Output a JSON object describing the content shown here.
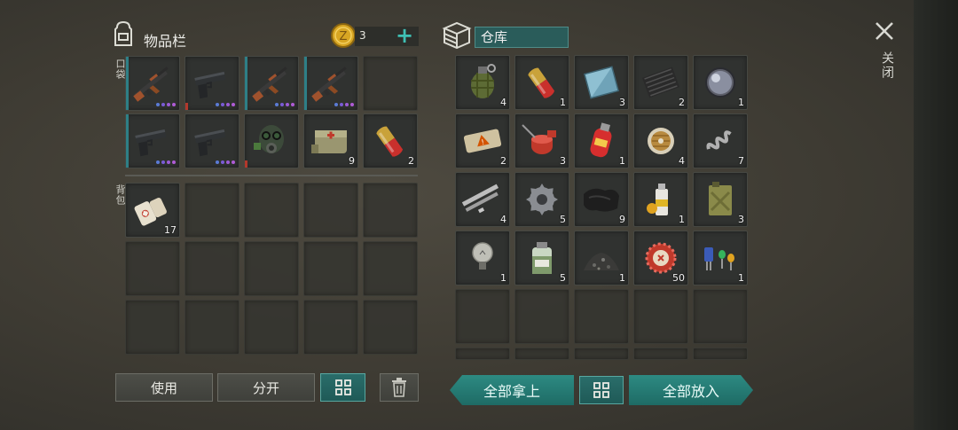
{
  "inventory": {
    "title": "物品栏",
    "coins": "3",
    "pocket_label": "口袋",
    "backpack_label": "背包",
    "pocket_items": [
      {
        "icon": "assault-rifle-icon",
        "count": ""
      },
      {
        "icon": "pistol-icon",
        "count": ""
      },
      {
        "icon": "assault-rifle-icon",
        "count": ""
      },
      {
        "icon": "assault-rifle-icon",
        "count": ""
      },
      {
        "icon": "",
        "count": ""
      },
      {
        "icon": "pistol-icon",
        "count": ""
      },
      {
        "icon": "pistol-icon",
        "count": ""
      },
      {
        "icon": "gas-mask-icon",
        "count": ""
      },
      {
        "icon": "medkit-bag-icon",
        "count": "9"
      },
      {
        "icon": "capsule-pill-icon",
        "count": "2"
      }
    ],
    "backpack_items": [
      {
        "icon": "bandage-roll-icon",
        "count": "17"
      }
    ],
    "buttons": {
      "use": "使用",
      "split": "分开"
    }
  },
  "warehouse": {
    "title": "仓库",
    "items": [
      {
        "icon": "grenade-icon",
        "count": "4"
      },
      {
        "icon": "capsule-pill-icon",
        "count": "1"
      },
      {
        "icon": "metal-plate-icon",
        "count": "3"
      },
      {
        "icon": "carbon-sheet-icon",
        "count": "2"
      },
      {
        "icon": "lens-icon",
        "count": "1"
      },
      {
        "icon": "explosive-block-icon",
        "count": "2"
      },
      {
        "icon": "oil-can-icon",
        "count": "3"
      },
      {
        "icon": "gas-cylinder-icon",
        "count": "1"
      },
      {
        "icon": "wire-spool-icon",
        "count": "4"
      },
      {
        "icon": "spring-icon",
        "count": "7"
      },
      {
        "icon": "metal-pipes-icon",
        "count": "4"
      },
      {
        "icon": "gear-icon",
        "count": "5"
      },
      {
        "icon": "fabric-icon",
        "count": "9"
      },
      {
        "icon": "spray-paint-icon",
        "count": "1"
      },
      {
        "icon": "jerry-can-icon",
        "count": "3"
      },
      {
        "icon": "light-bulb-icon",
        "count": "1"
      },
      {
        "icon": "chemical-jar-icon",
        "count": "5"
      },
      {
        "icon": "gravel-pile-icon",
        "count": "1"
      },
      {
        "icon": "bottle-cap-icon",
        "count": "50"
      },
      {
        "icon": "electronic-parts-icon",
        "count": "1"
      }
    ],
    "buttons": {
      "take_all": "全部拿上",
      "put_all": "全部放入"
    }
  },
  "close_label": "关闭"
}
